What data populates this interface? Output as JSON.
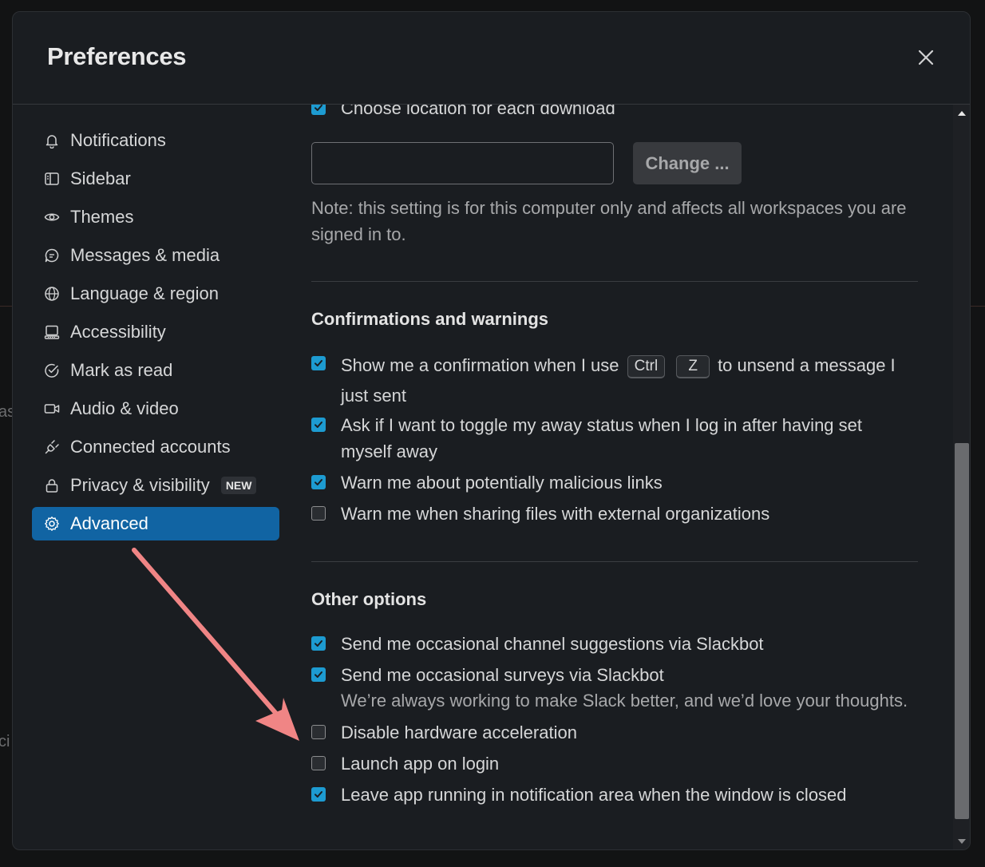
{
  "background": {
    "fragments": [
      "as",
      "ci"
    ]
  },
  "dialog": {
    "title": "Preferences",
    "close_icon": "close-icon"
  },
  "sidebar": {
    "items": [
      {
        "label": "Notifications",
        "icon": "bell-icon"
      },
      {
        "label": "Sidebar",
        "icon": "sidebar-icon"
      },
      {
        "label": "Themes",
        "icon": "eye-icon"
      },
      {
        "label": "Messages & media",
        "icon": "message-icon"
      },
      {
        "label": "Language & region",
        "icon": "globe-icon"
      },
      {
        "label": "Accessibility",
        "icon": "keyboard-icon"
      },
      {
        "label": "Mark as read",
        "icon": "check-circle-icon"
      },
      {
        "label": "Audio & video",
        "icon": "video-icon"
      },
      {
        "label": "Connected accounts",
        "icon": "plug-icon"
      },
      {
        "label": "Privacy & visibility",
        "icon": "lock-icon",
        "badge": "NEW"
      },
      {
        "label": "Advanced",
        "icon": "gear-icon",
        "active": true
      }
    ]
  },
  "downloads": {
    "choose_location_label": "Choose location for each download",
    "choose_location_checked": true,
    "path_value": "",
    "change_button": "Change ...",
    "note": "Note: this setting is for this computer only and affects all workspaces you are signed in to."
  },
  "confirmations": {
    "title": "Confirmations and warnings",
    "unsend": {
      "prefix": "Show me a confirmation when I use",
      "key1": "Ctrl",
      "key2": "Z",
      "suffix": "to unsend a message I just sent",
      "checked": true
    },
    "items": [
      {
        "label": "Ask if I want to toggle my away status when I log in after having set myself away",
        "checked": true
      },
      {
        "label": "Warn me about potentially malicious links",
        "checked": true
      },
      {
        "label": "Warn me when sharing files with external organizations",
        "checked": false
      }
    ]
  },
  "other_options": {
    "title": "Other options",
    "items": [
      {
        "label": "Send me occasional channel suggestions via Slackbot",
        "checked": true
      },
      {
        "label": "Send me occasional surveys via Slackbot",
        "checked": true,
        "note": "We’re always working to make Slack better, and we’d love your thoughts."
      },
      {
        "label": "Disable hardware acceleration",
        "checked": false
      },
      {
        "label": "Launch app on login",
        "checked": false
      },
      {
        "label": "Leave app running in notification area when the window is closed",
        "checked": true
      }
    ]
  },
  "scrollbar": {
    "position": 0.45,
    "visible_fraction": 0.53
  },
  "colors": {
    "accent": "#1164a3",
    "checkbox_on": "#1d9bd1",
    "annotation_arrow": "#f08585"
  }
}
